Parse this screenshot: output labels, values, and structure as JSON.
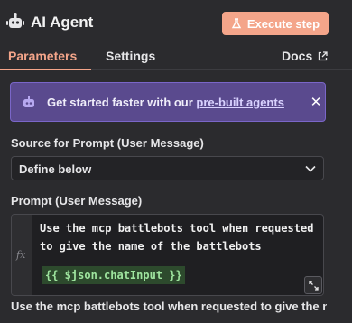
{
  "header": {
    "title": "AI Agent",
    "execute_label": "Execute step",
    "icon": "robot-icon",
    "accent": "#f4a58a"
  },
  "tabs": {
    "parameters": "Parameters",
    "settings": "Settings",
    "docs": "Docs"
  },
  "banner": {
    "text": "Get started faster with our ",
    "link": "pre-built agents",
    "close": "✕",
    "background": "#5a4a8e"
  },
  "source": {
    "label": "Source for Prompt (User Message)",
    "value": "Define below"
  },
  "prompt": {
    "label": "Prompt (User Message)",
    "fx": "fx",
    "line1": "Use the mcp battlebots tool when requested",
    "line2": "to give the name of the battlebots",
    "expression": "{{ $json.chatInput }}",
    "preview": "Use the mcp battlebots tool when requested to give the na..."
  }
}
